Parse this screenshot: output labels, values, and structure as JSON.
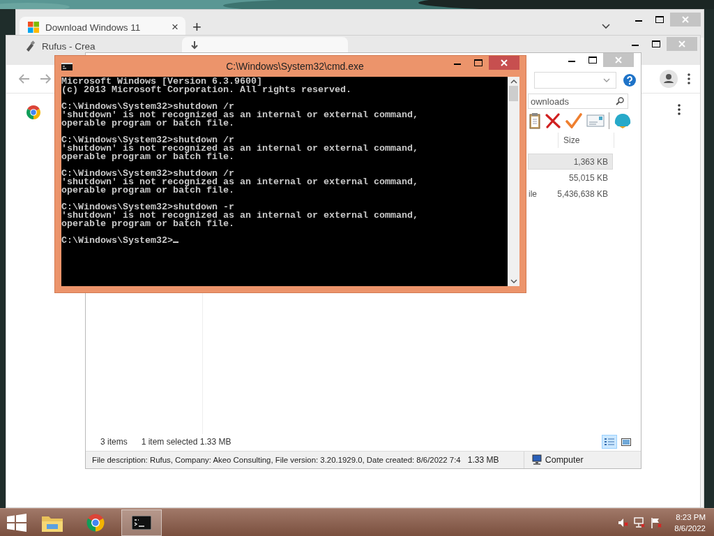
{
  "browser_back": {
    "tabs": [
      {
        "kind": "windows",
        "title": "Download Windows 11",
        "close": "×",
        "selected": true
      }
    ],
    "new_tab": "+"
  },
  "browser_front": {
    "tabs": [
      {
        "kind": "usb",
        "title": "Rufus - Crea",
        "selected": false
      },
      {
        "kind": "download",
        "selected": true
      }
    ]
  },
  "explorer": {
    "search": {
      "placeholder": "ownloads"
    },
    "columns": [
      {
        "label": "Size"
      }
    ],
    "rows": [
      {
        "size": "1,363 KB",
        "selected": true
      },
      {
        "size": "55,015 KB",
        "selected": false
      },
      {
        "column_1": "ile",
        "size": "5,436,638 KB",
        "selected": false
      }
    ],
    "status": {
      "items": "3 items",
      "selection": "1 item selected  1.33 MB"
    },
    "views": [
      {
        "kind": "details",
        "selected": true
      },
      {
        "kind": "preview",
        "selected": false
      }
    ],
    "details_bar": {
      "description": "File description: Rufus, Company: Akeo Consulting, File version: 3.20.1929.0, Date created: 8/6/2022 7:4",
      "size": "1.33 MB",
      "location": "Computer"
    }
  },
  "console": {
    "title": "C:\\Windows\\System32\\cmd.exe",
    "cursor": true,
    "blocks": [
      [
        "Microsoft Windows [Version 6.3.9600]",
        "(c) 2013 Microsoft Corporation. All rights reserved."
      ],
      [
        "C:\\Windows\\System32>shutdown /r",
        "'shutdown' is not recognized as an internal or external command,",
        "operable program or batch file."
      ],
      [
        "C:\\Windows\\System32>shutdown /r",
        "'shutdown' is not recognized as an internal or external command,",
        "operable program or batch file."
      ],
      [
        "C:\\Windows\\System32>shutdown /r",
        "'shutdown' is not recognized as an internal or external command,",
        "operable program or batch file."
      ],
      [
        "C:\\Windows\\System32>shutdown -r",
        "'shutdown' is not recognized as an internal or external command,",
        "operable program or batch file."
      ],
      [
        "C:\\Windows\\System32>"
      ]
    ]
  },
  "taskbar": {
    "apps": [
      {
        "kind": "explorer",
        "selected": false
      },
      {
        "kind": "chrome",
        "selected": false
      },
      {
        "kind": "console",
        "selected": true
      }
    ],
    "tray": [
      {
        "kind": "volume-muted"
      },
      {
        "kind": "network"
      },
      {
        "kind": "flag"
      }
    ],
    "time": "8:23 PM",
    "date": "8/6/2022"
  }
}
